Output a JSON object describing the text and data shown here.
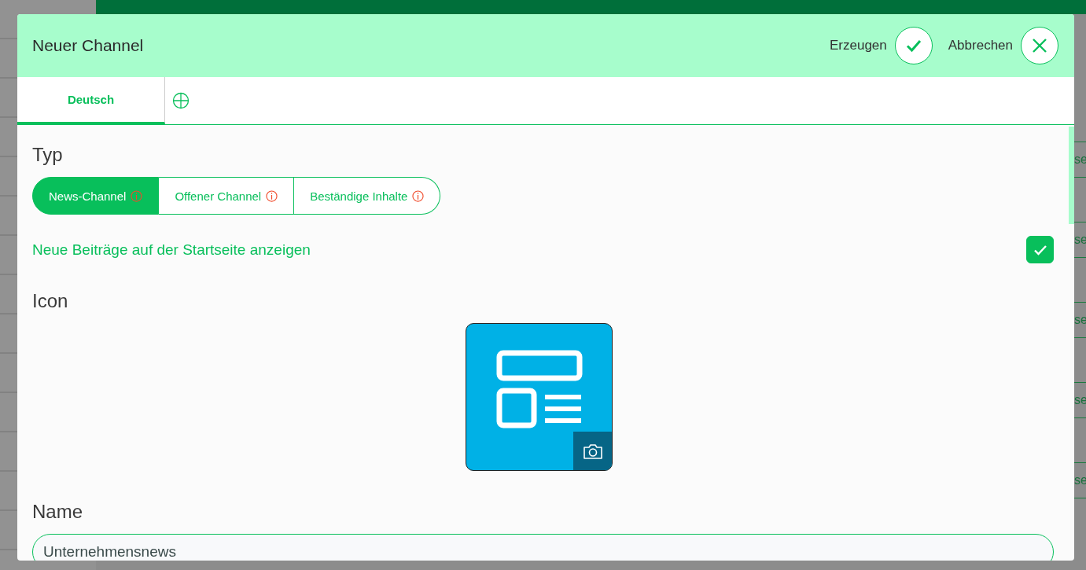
{
  "background": {
    "row_fragments": [
      "se",
      "se",
      "se",
      "se",
      "se"
    ]
  },
  "dialog": {
    "title": "Neuer Channel",
    "actions": [
      {
        "kind": "confirm",
        "label": "Erzeugen"
      },
      {
        "kind": "cancel",
        "label": "Abbrechen"
      }
    ]
  },
  "tabs": [
    {
      "label": "Deutsch",
      "selected": true
    }
  ],
  "type_section": {
    "label": "Typ",
    "options": [
      {
        "label": "News-Channel",
        "selected": true
      },
      {
        "label": "Offener Channel",
        "selected": false
      },
      {
        "label": "Beständige Inhalte",
        "selected": false
      }
    ]
  },
  "show_on_start": {
    "label": "Neue Beiträge auf der Startseite anzeigen",
    "checked": true
  },
  "icon_section": {
    "label": "Icon"
  },
  "name_section": {
    "label": "Name",
    "value": "Unternehmensnews"
  }
}
